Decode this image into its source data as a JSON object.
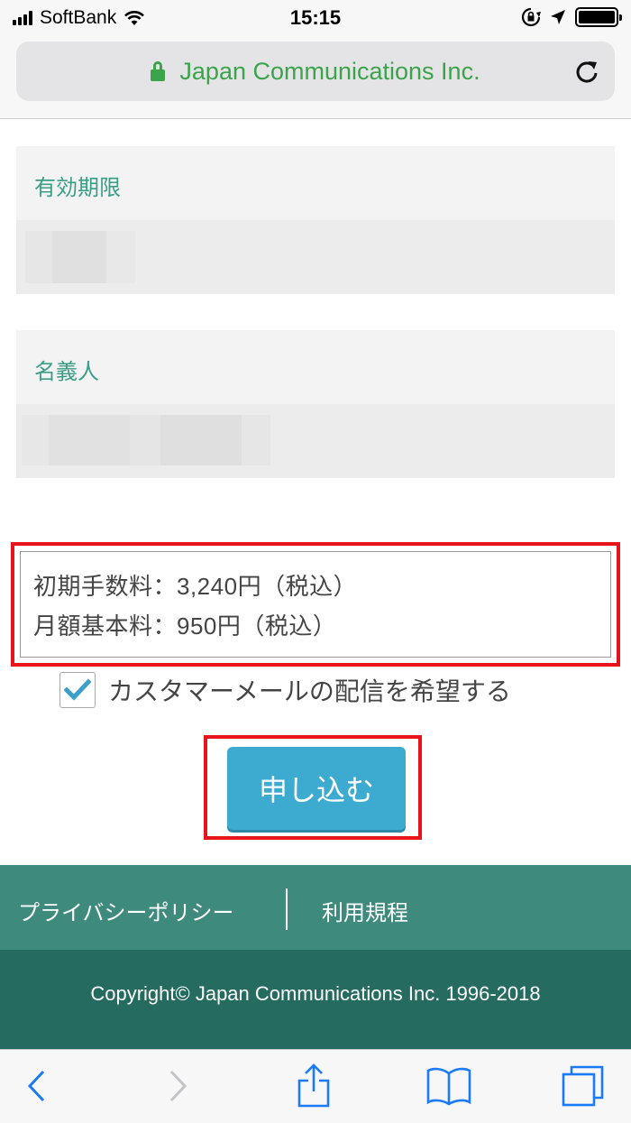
{
  "status_bar": {
    "carrier": "SoftBank",
    "time": "15:15"
  },
  "browser": {
    "site_title": "Japan Communications Inc."
  },
  "form": {
    "expiry_label": "有効期限",
    "holder_label": "名義人"
  },
  "fees": {
    "initial_fee": "初期手数料：3,240円（税込）",
    "monthly_fee": "月額基本料：950円（税込）"
  },
  "newsletter": {
    "label": "カスタマーメールの配信を希望する",
    "checked": true
  },
  "submit_label": "申し込む",
  "footer": {
    "privacy_link": "プライバシーポリシー",
    "terms_link": "利用規程",
    "copyright": "Copyright© Japan Communications Inc. 1996-2018"
  },
  "colors": {
    "accent_green": "#3aa44a",
    "label_teal": "#3a9d86",
    "button_blue": "#3daad0",
    "highlight_red": "#e8141b",
    "footer_top": "#3e8a7d",
    "footer_bottom": "#256b60",
    "ios_blue": "#1a7af8"
  },
  "icons": {
    "status": [
      "signal-icon",
      "wifi-icon",
      "rotation-lock-icon",
      "location-icon",
      "battery-icon"
    ],
    "address": [
      "lock-icon",
      "reload-icon"
    ],
    "toolbar": [
      "back-icon",
      "forward-icon",
      "share-icon",
      "bookmarks-icon",
      "tabs-icon"
    ]
  }
}
